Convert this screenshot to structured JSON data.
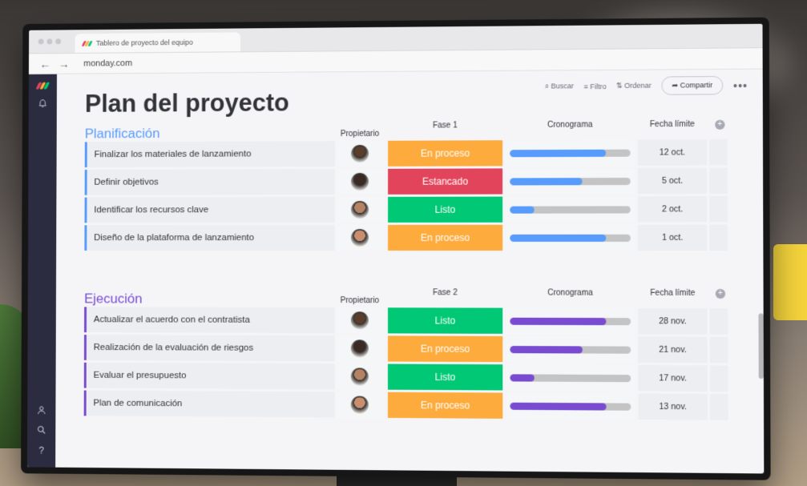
{
  "browser": {
    "tab_title": "Tablero de proyecto del equipo",
    "url": "monday.com",
    "back_icon": "arrow-left-icon",
    "forward_icon": "arrow-right-icon"
  },
  "sidebar": {
    "icons": [
      "monday-logo",
      "bell-icon",
      "person-icon",
      "search-icon",
      "help-icon"
    ],
    "help_label": "?"
  },
  "header": {
    "title": "Plan del proyecto",
    "search_label": "Buscar",
    "filter_label": "Filtro",
    "sort_label": "Ordenar",
    "share_label": "Compartir",
    "more_label": "•••"
  },
  "colors": {
    "planning": "#579bfc",
    "execution": "#784bd1",
    "in_progress": "#fdab3d",
    "stuck": "#e2445c",
    "done": "#00c875"
  },
  "groups": [
    {
      "title": "Planificación",
      "color": "#579bfc",
      "columns": {
        "owner": "Propietario",
        "phase": "Fase 1",
        "timeline": "Cronograma",
        "due": "Fecha límite"
      },
      "rows": [
        {
          "item": "Finalizar los materiales de lanzamiento",
          "status": "En proceso",
          "status_color": "#fdab3d",
          "progress": 0.8,
          "due": "12 oct."
        },
        {
          "item": "Definir objetivos",
          "status": "Estancado",
          "status_color": "#e2445c",
          "progress": 0.6,
          "due": "5 oct."
        },
        {
          "item": "Identificar los recursos clave",
          "status": "Listo",
          "status_color": "#00c875",
          "progress": 0.2,
          "due": "2 oct."
        },
        {
          "item": "Diseño de la plataforma de lanzamiento",
          "status": "En proceso",
          "status_color": "#fdab3d",
          "progress": 0.8,
          "due": "1 oct."
        }
      ]
    },
    {
      "title": "Ejecución",
      "color": "#784bd1",
      "columns": {
        "owner": "Propietario",
        "phase": "Fase 2",
        "timeline": "Cronograma",
        "due": "Fecha límite"
      },
      "rows": [
        {
          "item": "Actualizar el acuerdo con el contratista",
          "status": "Listo",
          "status_color": "#00c875",
          "progress": 0.8,
          "due": "28 nov."
        },
        {
          "item": "Realización de la evaluación de riesgos",
          "status": "En proceso",
          "status_color": "#fdab3d",
          "progress": 0.6,
          "due": "21 nov."
        },
        {
          "item": "Evaluar el presupuesto",
          "status": "Listo",
          "status_color": "#00c875",
          "progress": 0.2,
          "due": "17 nov."
        },
        {
          "item": "Plan de comunicación",
          "status": "En proceso",
          "status_color": "#fdab3d",
          "progress": 0.8,
          "due": "13 nov."
        }
      ]
    }
  ]
}
